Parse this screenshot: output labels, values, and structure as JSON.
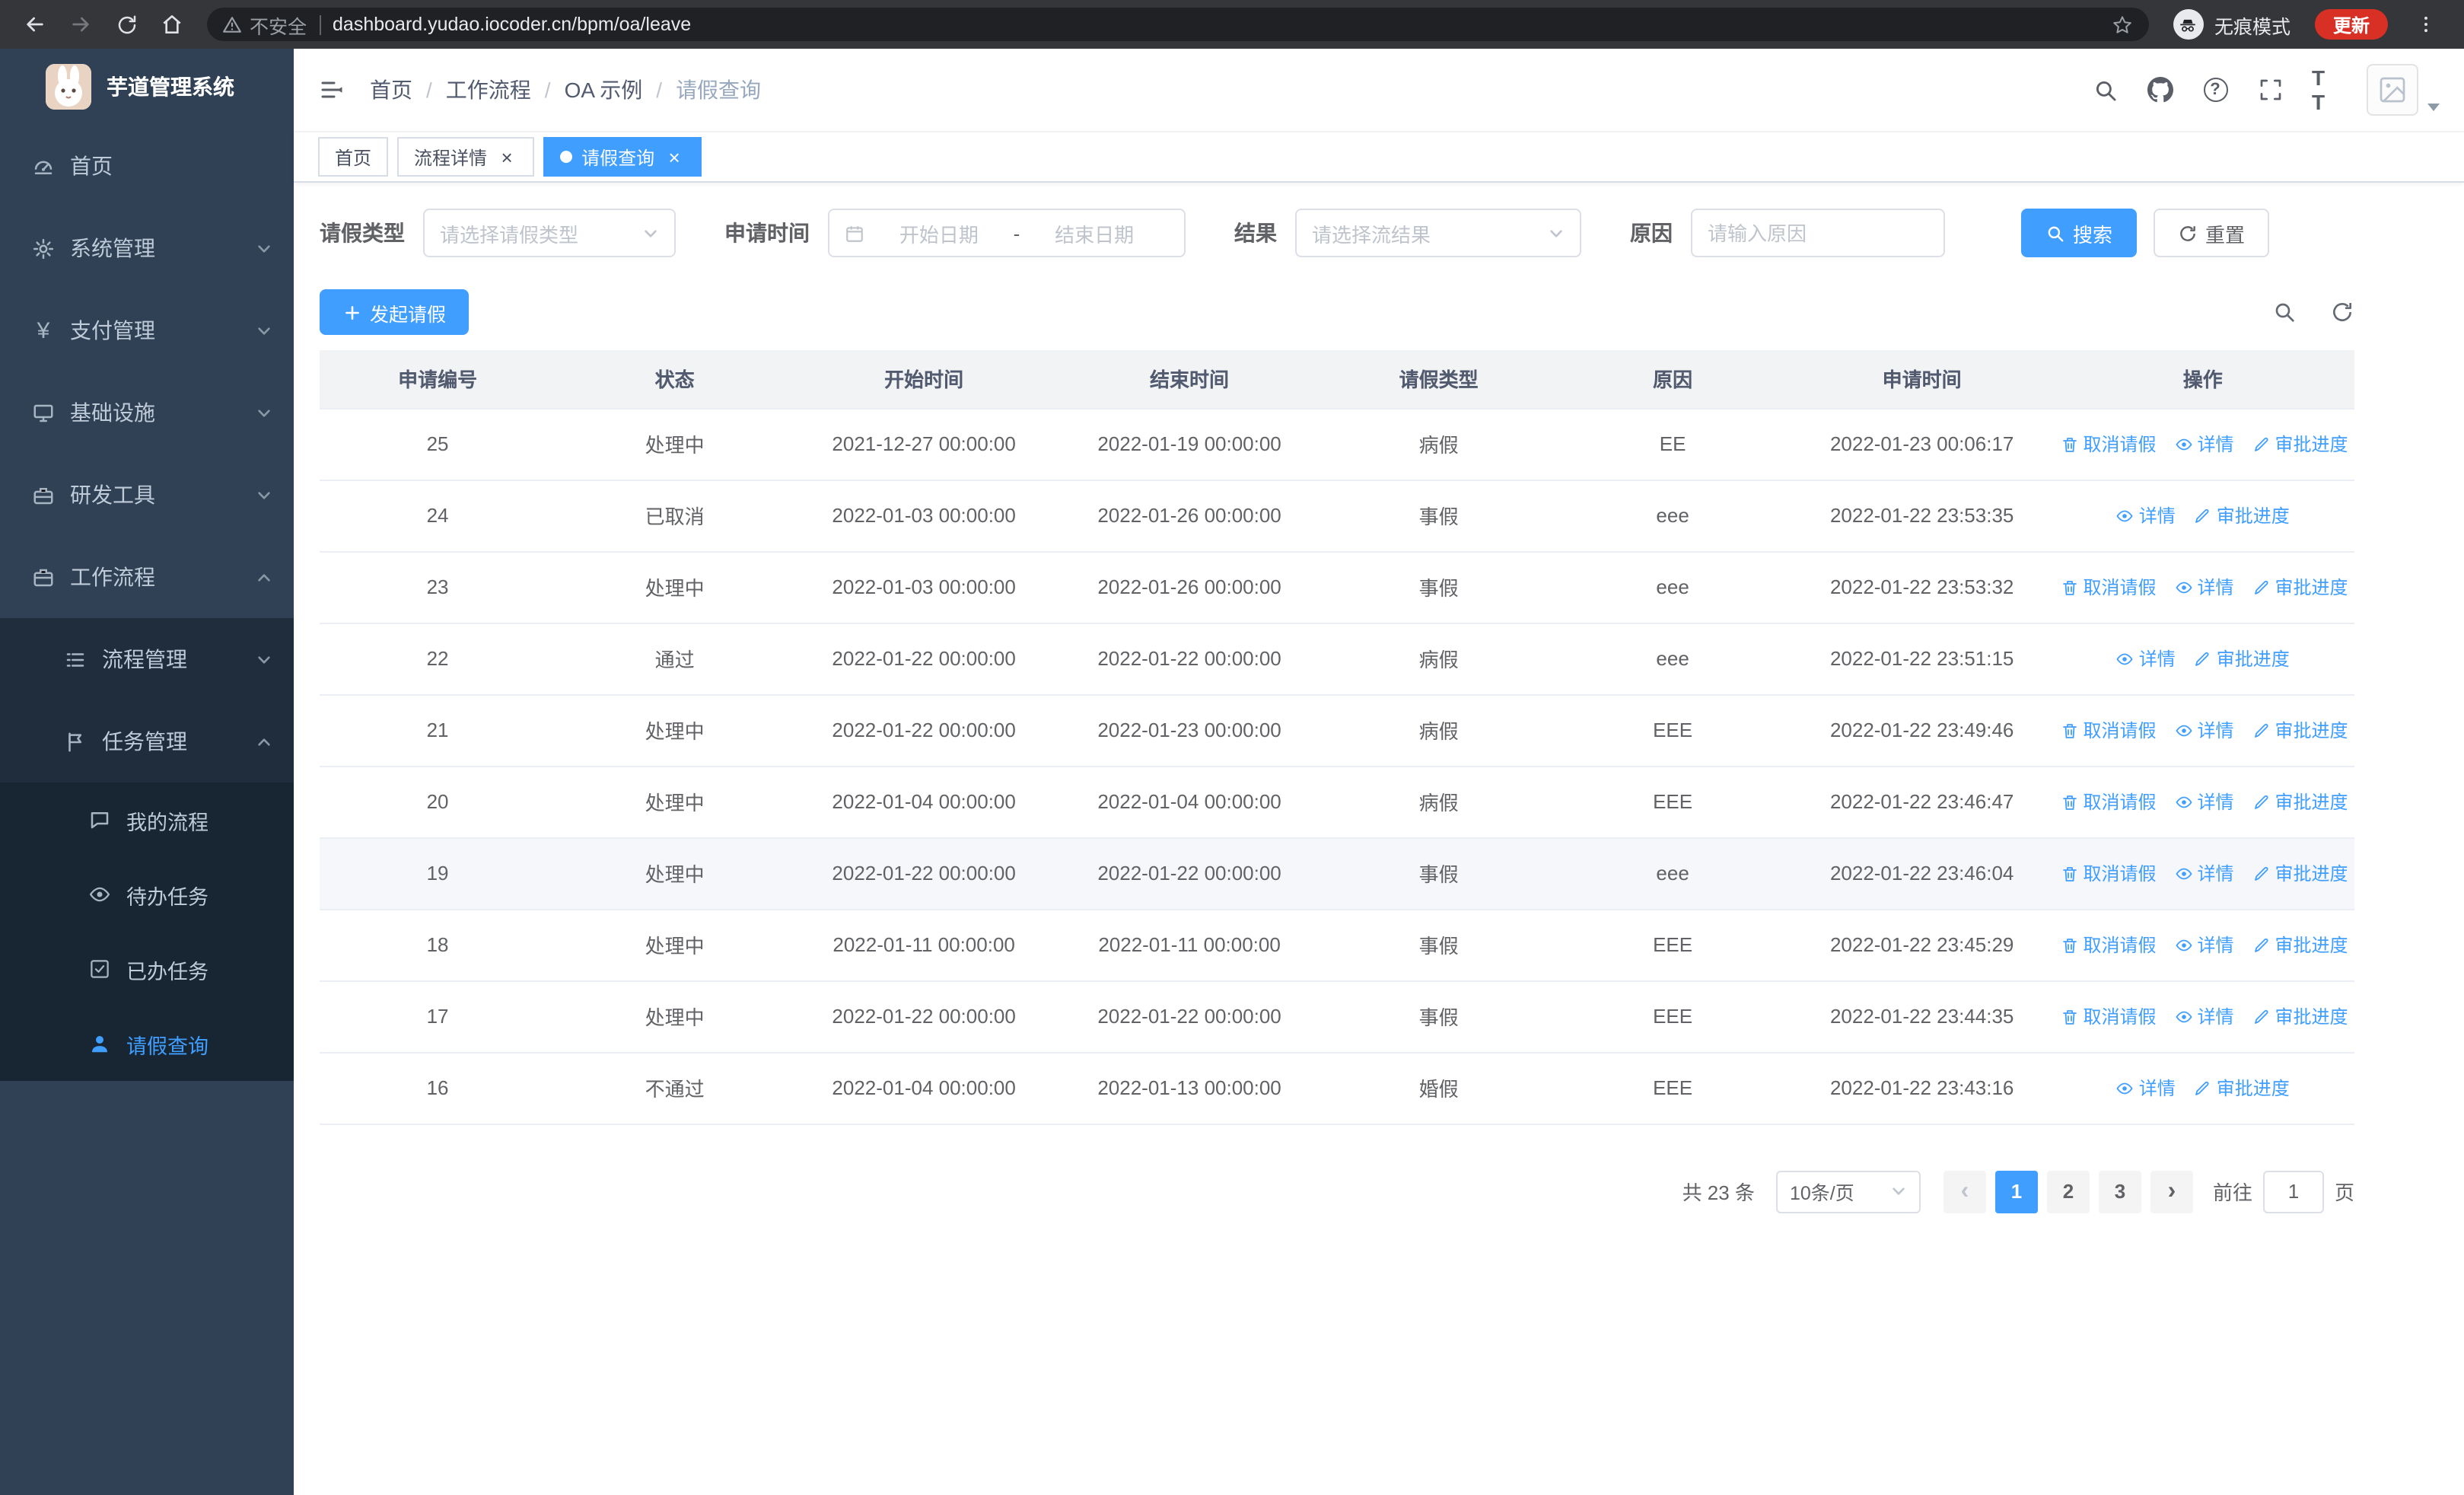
{
  "theme": {
    "accent": "#409eff",
    "sidebar_bg": "#304156",
    "submenu_bg": "#1f2d3d",
    "update_badge": "#d93025"
  },
  "browser": {
    "security_label": "不安全",
    "url": "dashboard.yudao.iocoder.cn/bpm/oa/leave",
    "incognito_label": "无痕模式",
    "update_label": "更新"
  },
  "sidebar": {
    "logo_title": "芋道管理系统",
    "items": [
      {
        "label": "首页"
      },
      {
        "label": "系统管理"
      },
      {
        "label": "支付管理"
      },
      {
        "label": "基础设施"
      },
      {
        "label": "研发工具"
      },
      {
        "label": "工作流程"
      },
      {
        "label": "流程管理"
      },
      {
        "label": "任务管理"
      },
      {
        "label": "我的流程"
      },
      {
        "label": "待办任务"
      },
      {
        "label": "已办任务"
      },
      {
        "label": "请假查询"
      }
    ]
  },
  "navbar": {
    "breadcrumb": [
      "首页",
      "工作流程",
      "OA 示例",
      "请假查询"
    ]
  },
  "tabs": [
    {
      "label": "首页"
    },
    {
      "label": "流程详情"
    },
    {
      "label": "请假查询"
    }
  ],
  "filters": {
    "leave_type": {
      "label": "请假类型",
      "placeholder": "请选择请假类型"
    },
    "apply_time": {
      "label": "申请时间",
      "start_placeholder": "开始日期",
      "separator": "-",
      "end_placeholder": "结束日期"
    },
    "result": {
      "label": "结果",
      "placeholder": "请选择流结果"
    },
    "reason": {
      "label": "原因",
      "placeholder": "请输入原因"
    },
    "search_label": "搜索",
    "reset_label": "重置"
  },
  "toolbar": {
    "create_label": "发起请假"
  },
  "table": {
    "columns": [
      "申请编号",
      "状态",
      "开始时间",
      "结束时间",
      "请假类型",
      "原因",
      "申请时间",
      "操作"
    ],
    "action_labels": {
      "cancel": "取消请假",
      "detail": "详情",
      "progress": "审批进度"
    },
    "rows": [
      {
        "id": "25",
        "status": "处理中",
        "start": "2021-12-27 00:00:00",
        "end": "2022-01-19 00:00:00",
        "type": "病假",
        "reason": "EE",
        "applied": "2022-01-23 00:06:17",
        "actions": [
          "cancel",
          "detail",
          "progress"
        ],
        "highlight": false
      },
      {
        "id": "24",
        "status": "已取消",
        "start": "2022-01-03 00:00:00",
        "end": "2022-01-26 00:00:00",
        "type": "事假",
        "reason": "eee",
        "applied": "2022-01-22 23:53:35",
        "actions": [
          "detail",
          "progress"
        ],
        "highlight": false
      },
      {
        "id": "23",
        "status": "处理中",
        "start": "2022-01-03 00:00:00",
        "end": "2022-01-26 00:00:00",
        "type": "事假",
        "reason": "eee",
        "applied": "2022-01-22 23:53:32",
        "actions": [
          "cancel",
          "detail",
          "progress"
        ],
        "highlight": false
      },
      {
        "id": "22",
        "status": "通过",
        "start": "2022-01-22 00:00:00",
        "end": "2022-01-22 00:00:00",
        "type": "病假",
        "reason": "eee",
        "applied": "2022-01-22 23:51:15",
        "actions": [
          "detail",
          "progress"
        ],
        "highlight": false
      },
      {
        "id": "21",
        "status": "处理中",
        "start": "2022-01-22 00:00:00",
        "end": "2022-01-23 00:00:00",
        "type": "病假",
        "reason": "EEE",
        "applied": "2022-01-22 23:49:46",
        "actions": [
          "cancel",
          "detail",
          "progress"
        ],
        "highlight": false
      },
      {
        "id": "20",
        "status": "处理中",
        "start": "2022-01-04 00:00:00",
        "end": "2022-01-04 00:00:00",
        "type": "病假",
        "reason": "EEE",
        "applied": "2022-01-22 23:46:47",
        "actions": [
          "cancel",
          "detail",
          "progress"
        ],
        "highlight": false
      },
      {
        "id": "19",
        "status": "处理中",
        "start": "2022-01-22 00:00:00",
        "end": "2022-01-22 00:00:00",
        "type": "事假",
        "reason": "eee",
        "applied": "2022-01-22 23:46:04",
        "actions": [
          "cancel",
          "detail",
          "progress"
        ],
        "highlight": true
      },
      {
        "id": "18",
        "status": "处理中",
        "start": "2022-01-11 00:00:00",
        "end": "2022-01-11 00:00:00",
        "type": "事假",
        "reason": "EEE",
        "applied": "2022-01-22 23:45:29",
        "actions": [
          "cancel",
          "detail",
          "progress"
        ],
        "highlight": false
      },
      {
        "id": "17",
        "status": "处理中",
        "start": "2022-01-22 00:00:00",
        "end": "2022-01-22 00:00:00",
        "type": "事假",
        "reason": "EEE",
        "applied": "2022-01-22 23:44:35",
        "actions": [
          "cancel",
          "detail",
          "progress"
        ],
        "highlight": false
      },
      {
        "id": "16",
        "status": "不通过",
        "start": "2022-01-04 00:00:00",
        "end": "2022-01-13 00:00:00",
        "type": "婚假",
        "reason": "EEE",
        "applied": "2022-01-22 23:43:16",
        "actions": [
          "detail",
          "progress"
        ],
        "highlight": false
      }
    ]
  },
  "pagination": {
    "total_text": "共 23 条",
    "page_size": "10条/页",
    "pages": [
      "1",
      "2",
      "3"
    ],
    "active_page": "1",
    "goto_prefix": "前往",
    "goto_value": "1",
    "goto_suffix": "页"
  }
}
